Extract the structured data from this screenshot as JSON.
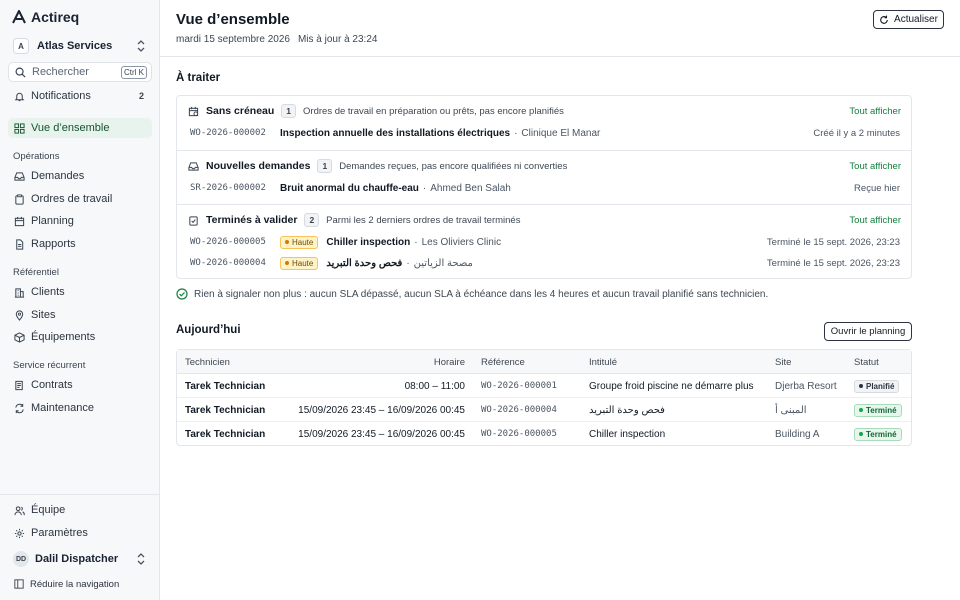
{
  "app": {
    "name": "Actireq"
  },
  "workspace": {
    "name": "Atlas Services",
    "initial": "A"
  },
  "search": {
    "placeholder": "Rechercher",
    "shortcut": "Ctrl K"
  },
  "sidebar": {
    "notifications": {
      "label": "Notifications",
      "count": "2"
    },
    "overview": {
      "label": "Vue d’ensemble"
    },
    "operations": {
      "title": "Opérations",
      "items": [
        {
          "label": "Demandes",
          "icon": "inbox-icon"
        },
        {
          "label": "Ordres de travail",
          "icon": "clipboard-icon"
        },
        {
          "label": "Planning",
          "icon": "calendar-icon"
        },
        {
          "label": "Rapports",
          "icon": "file-icon"
        }
      ]
    },
    "reference": {
      "title": "Référentiel",
      "items": [
        {
          "label": "Clients",
          "icon": "building-icon"
        },
        {
          "label": "Sites",
          "icon": "map-pin-icon"
        },
        {
          "label": "Équipements",
          "icon": "box-icon"
        }
      ]
    },
    "recurring": {
      "title": "Service récurrent",
      "items": [
        {
          "label": "Contrats",
          "icon": "contract-icon"
        },
        {
          "label": "Maintenance",
          "icon": "repeat-icon"
        }
      ]
    },
    "bottom": {
      "team": "Équipe",
      "settings": "Paramètres",
      "user": {
        "name": "Dalil Dispatcher",
        "initials": "DD"
      },
      "collapse": "Réduire la navigation"
    }
  },
  "header": {
    "title": "Vue d’ensemble",
    "date": "mardi 15 septembre 2026",
    "updated": "Mis à jour à 23:24",
    "refresh": "Actualiser"
  },
  "todo": {
    "title": "À traiter",
    "groups": [
      {
        "title": "Sans créneau",
        "count": "1",
        "desc": "Ordres de travail en préparation ou prêts, pas encore planifiés",
        "link": "Tout afficher",
        "icon": "calendar-x-icon",
        "rows": [
          {
            "ref": "WO-2026-000002",
            "priority": "",
            "title": "Inspection annuelle des installations électriques",
            "client": "Clinique El Manar",
            "meta": "Créé il y a 2 minutes"
          }
        ]
      },
      {
        "title": "Nouvelles demandes",
        "count": "1",
        "desc": "Demandes reçues, pas encore qualifiées ni converties",
        "link": "Tout afficher",
        "icon": "inbox-icon",
        "rows": [
          {
            "ref": "SR-2026-000002",
            "priority": "",
            "title": "Bruit anormal du chauffe-eau",
            "client": "Ahmed Ben Salah",
            "meta": "Reçue hier"
          }
        ]
      },
      {
        "title": "Terminés à valider",
        "count": "2",
        "desc": "Parmi les 2 derniers ordres de travail terminés",
        "link": "Tout afficher",
        "icon": "clipboard-check-icon",
        "rows": [
          {
            "ref": "WO-2026-000005",
            "priority": "Haute",
            "title": "Chiller inspection",
            "client": "Les Oliviers Clinic",
            "meta": "Terminé le 15 sept. 2026, 23:23"
          },
          {
            "ref": "WO-2026-000004",
            "priority": "Haute",
            "title": "فحص وحدة التبريد",
            "client": "مصحة الزياتين",
            "meta": "Terminé le 15 sept. 2026, 23:23"
          }
        ]
      }
    ],
    "all_clear": "Rien à signaler non plus : aucun SLA dépassé, aucun SLA à échéance dans les 4 heures et aucun travail planifié sans technicien."
  },
  "today": {
    "title": "Aujourd’hui",
    "planning_button": "Ouvrir le planning",
    "columns": {
      "technician": "Technicien",
      "time": "Horaire",
      "ref": "Référence",
      "title": "Intitulé",
      "site": "Site",
      "status": "Statut"
    },
    "rows": [
      {
        "technician": "Tarek Technician",
        "time": "08:00 – 11:00",
        "ref": "WO-2026-000001",
        "title": "Groupe froid piscine ne démarre plus",
        "site": "Djerba Resort",
        "status": "Planifié",
        "status_kind": "planned"
      },
      {
        "technician": "Tarek Technician",
        "time": "15/09/2026 23:45 – 16/09/2026 00:45",
        "ref": "WO-2026-000004",
        "title": "فحص وحدة التبريد",
        "site": "المبنى أ",
        "status": "Terminé",
        "status_kind": "done"
      },
      {
        "technician": "Tarek Technician",
        "time": "15/09/2026 23:45 – 16/09/2026 00:45",
        "ref": "WO-2026-000005",
        "title": "Chiller inspection",
        "site": "Building A",
        "status": "Terminé",
        "status_kind": "done"
      }
    ]
  },
  "colors": {
    "accent": "#15803d",
    "priority_high": "#d97706",
    "status_done": "#16a34a"
  }
}
